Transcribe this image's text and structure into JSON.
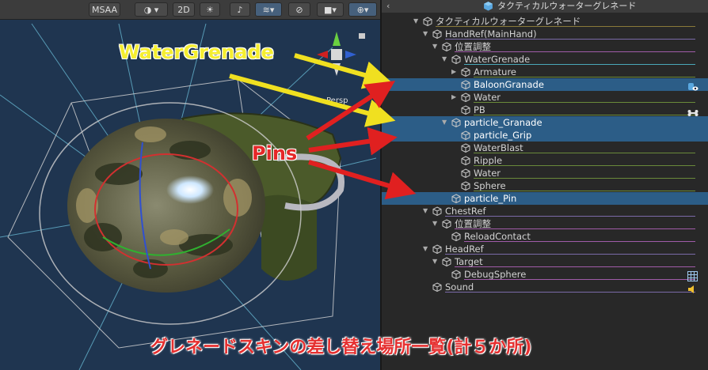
{
  "scene_toolbar": {
    "msaa": "MSAA",
    "mode_2d": "2D"
  },
  "scene_overlay": {
    "persp_label": "Persp"
  },
  "hierarchy": {
    "title": "タクティカルウォーターグレネード",
    "rows": [
      {
        "label": "タクティカルウォーターグレネード",
        "arrow": "▼",
        "line": "#8a7a3a",
        "selected": false
      },
      {
        "label": "HandRef(MainHand)",
        "arrow": "▼",
        "line": "#7a6aa8",
        "selected": false
      },
      {
        "label": "位置調整",
        "arrow": "▼",
        "line": "#a05ca8",
        "selected": false
      },
      {
        "label": "WaterGrenade",
        "arrow": "▼",
        "line": "#4aa8b8",
        "selected": false
      },
      {
        "label": "Armature",
        "arrow": "▶",
        "line": "#6a8a3a",
        "selected": false
      },
      {
        "label": "BaloonGranade",
        "arrow": "",
        "line": "",
        "selected": true
      },
      {
        "label": "Water",
        "arrow": "▶",
        "line": "#6a8a3a",
        "selected": false
      },
      {
        "label": "PB",
        "arrow": "",
        "line": "#6a8a3a",
        "selected": false
      },
      {
        "label": "particle_Granade",
        "arrow": "▼",
        "line": "",
        "selected": true
      },
      {
        "label": "particle_Grip",
        "arrow": "",
        "line": "",
        "selected": true
      },
      {
        "label": "WaterBlast",
        "arrow": "",
        "line": "#6a8a3a",
        "selected": false
      },
      {
        "label": "Ripple",
        "arrow": "",
        "line": "#6a8a3a",
        "selected": false
      },
      {
        "label": "Water",
        "arrow": "",
        "line": "#6a8a3a",
        "selected": false
      },
      {
        "label": "Sphere",
        "arrow": "",
        "line": "#6a8a3a",
        "selected": false
      },
      {
        "label": "particle_Pin",
        "arrow": "",
        "line": "",
        "selected": true
      },
      {
        "label": "ChestRef",
        "arrow": "▼",
        "line": "#7a6aa8",
        "selected": false
      },
      {
        "label": "位置調整",
        "arrow": "▼",
        "line": "#a05ca8",
        "selected": false
      },
      {
        "label": "ReloadContact",
        "arrow": "",
        "line": "#a05ca8",
        "selected": false
      },
      {
        "label": "HeadRef",
        "arrow": "▼",
        "line": "#7a6aa8",
        "selected": false
      },
      {
        "label": "Target",
        "arrow": "▼",
        "line": "#a05ca8",
        "selected": false
      },
      {
        "label": "DebugSphere",
        "arrow": "",
        "line": "#a05ca8",
        "selected": false
      },
      {
        "label": "Sound",
        "arrow": "",
        "line": "#7a6aa8",
        "selected": false
      }
    ]
  },
  "annotations": {
    "water_grenade_label": "WaterGrenade",
    "pins_label": "Pins",
    "caption": "グレネードスキンの差し替え場所一覧(計５か所)"
  },
  "colors": {
    "yellow_arrow": "#f0e020",
    "red_arrow": "#e02020",
    "selection": "#2c5d87"
  }
}
